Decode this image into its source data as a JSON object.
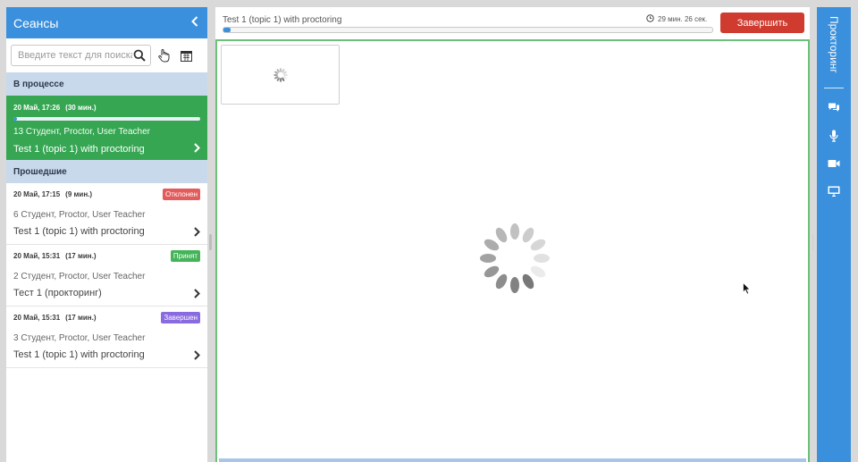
{
  "sidebar": {
    "title": "Сеансы",
    "search_placeholder": "Введите текст для поиска",
    "group_active": "В процессе",
    "group_past": "Прошедшие",
    "active_session": {
      "date": "20 Май, 17:26",
      "duration": "(30 мин.)",
      "progress": 0.02,
      "people": "13 Студент, Proctor, User Teacher",
      "title": "Test 1 (topic 1) with proctoring"
    },
    "past_sessions": [
      {
        "date": "20 Май, 17:15",
        "duration": "(9 мин.)",
        "badge": "Отклонен",
        "badge_color": "#e35b5b",
        "people": "6 Студент, Proctor, User Teacher",
        "title": "Test 1 (topic 1) with proctoring"
      },
      {
        "date": "20 Май, 15:31",
        "duration": "(17 мин.)",
        "badge": "Принят",
        "badge_color": "#45b35a",
        "people": "2 Студент, Proctor, User Teacher",
        "title": "Тест 1 (прокторинг)"
      },
      {
        "date": "20 Май, 15:31",
        "duration": "(17 мин.)",
        "badge": "Завершен",
        "badge_color": "#8a6ae0",
        "people": "3 Студент, Proctor, User Teacher",
        "title": "Test 1 (topic 1) with proctoring"
      }
    ]
  },
  "main": {
    "test_title": "Test 1 (topic 1) with proctoring",
    "progress": 0.015,
    "timer": "29 мин. 26 сек.",
    "finish_label": "Завершить"
  },
  "right_panel": {
    "title": "Прокторинг",
    "icons": [
      "chat-icon",
      "microphone-icon",
      "camera-icon",
      "screen-icon"
    ]
  },
  "colors": {
    "primary": "#3a90dd",
    "active_session": "#36a653",
    "finish_button": "#cf3b2f",
    "stage_border": "#6cc07a"
  }
}
